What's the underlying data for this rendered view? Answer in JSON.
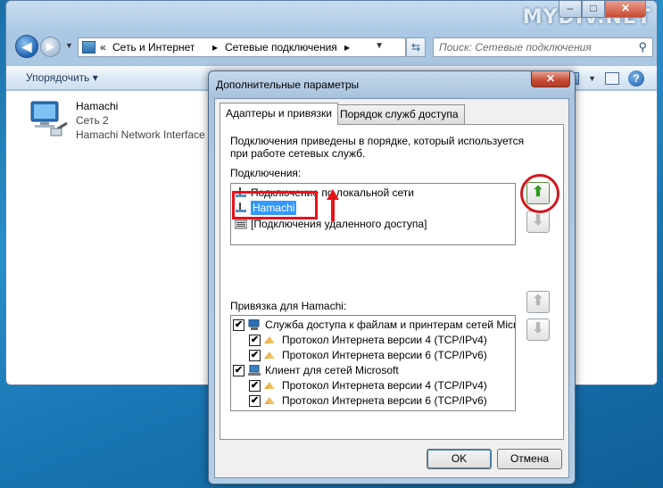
{
  "watermark": "MYDIV.NET",
  "explorer": {
    "breadcrumbs": [
      "Сеть и Интернет",
      "Сетевые подключения"
    ],
    "search_placeholder": "Поиск: Сетевые подключения",
    "organize_label": "Упорядочить ▾",
    "help_label": "?",
    "connection": {
      "name": "Hamachi",
      "network": "Сеть  2",
      "device": "Hamachi Network Interface"
    }
  },
  "dialog": {
    "title": "Дополнительные параметры",
    "close_label": "✕",
    "tabs": [
      "Адаптеры и привязки",
      "Порядок служб доступа"
    ],
    "description": "Подключения приведены в порядке, который используется при работе сетевых служб.",
    "connections_label": "Подключения:",
    "connections": [
      "Подключение по локальной сети",
      "Hamachi",
      "[Подключения удаленного доступа]"
    ],
    "bindings_label": "Привязка для Hamachi:",
    "bindings": [
      {
        "label": "Служба доступа к файлам и принтерам сетей Microsoft",
        "checked": true,
        "level": 0,
        "icon": "network-service-icon"
      },
      {
        "label": "Протокол Интернета версии 4 (TCP/IPv4)",
        "checked": true,
        "level": 1,
        "icon": "protocol-icon"
      },
      {
        "label": "Протокол Интернета версии 6 (TCP/IPv6)",
        "checked": true,
        "level": 1,
        "icon": "protocol-icon"
      },
      {
        "label": "Клиент для сетей Microsoft",
        "checked": true,
        "level": 0,
        "icon": "client-icon"
      },
      {
        "label": "Протокол Интернета версии 4 (TCP/IPv4)",
        "checked": true,
        "level": 1,
        "icon": "protocol-icon"
      },
      {
        "label": "Протокол Интернета версии 6 (TCP/IPv6)",
        "checked": true,
        "level": 1,
        "icon": "protocol-icon"
      }
    ],
    "ok_label": "OK",
    "cancel_label": "Отмена"
  },
  "colors": {
    "annotation_red": "#e8121b",
    "selection_blue": "#3399ff",
    "up_arrow_green": "#2f9b1f"
  }
}
